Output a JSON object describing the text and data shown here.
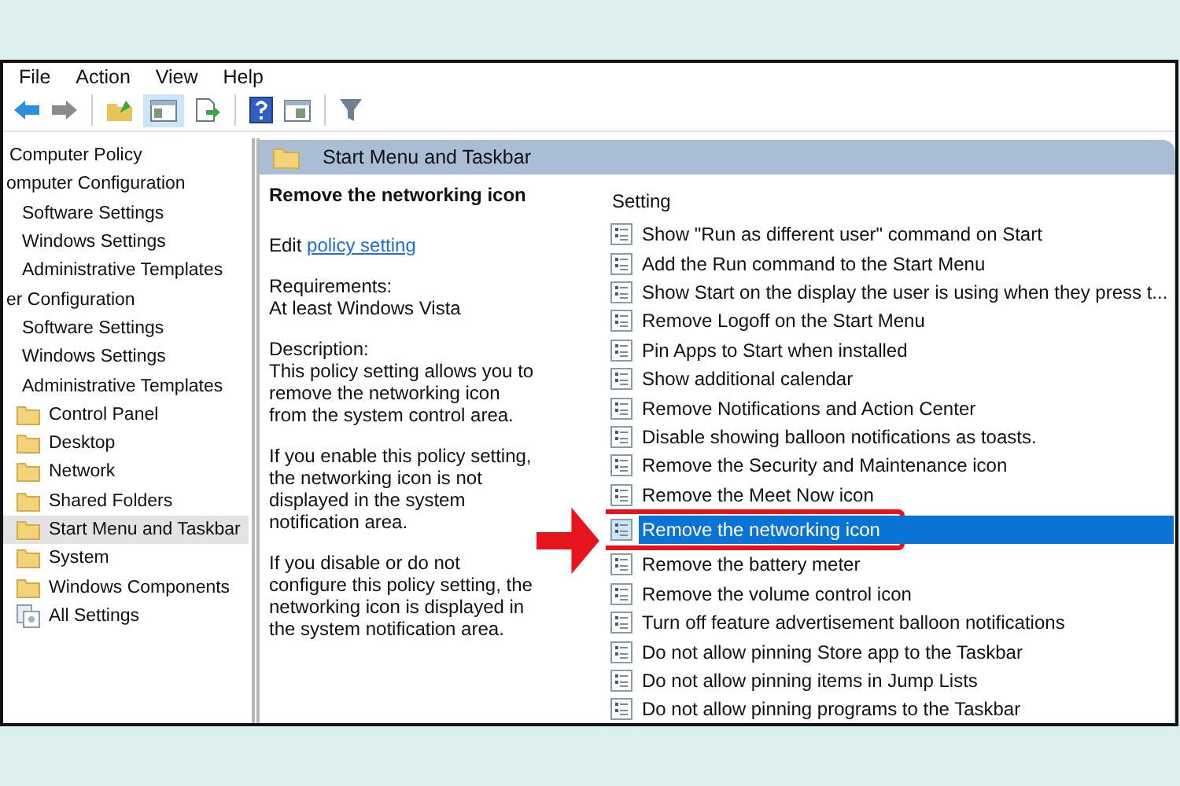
{
  "menu": [
    "File",
    "Action",
    "View",
    "Help"
  ],
  "toolbar": {
    "tree_toggle_on": true
  },
  "tree": [
    {
      "label": "Computer Policy",
      "selected": false,
      "children": [
        {
          "label": "omputer Configuration",
          "selected": false,
          "children": [
            {
              "label": "Software Settings",
              "selected": false
            },
            {
              "label": "Windows Settings",
              "selected": false
            },
            {
              "label": "Administrative Templates",
              "selected": false
            }
          ]
        },
        {
          "label": "er Configuration",
          "selected": false,
          "children": [
            {
              "label": "Software Settings",
              "selected": false
            },
            {
              "label": "Windows Settings",
              "selected": false
            },
            {
              "label": "Administrative Templates",
              "selected": false,
              "children": [
                {
                  "label": "Control Panel",
                  "selected": false,
                  "kind": "folder"
                },
                {
                  "label": "Desktop",
                  "selected": false,
                  "kind": "folder"
                },
                {
                  "label": "Network",
                  "selected": false,
                  "kind": "folder"
                },
                {
                  "label": "Shared Folders",
                  "selected": false,
                  "kind": "folder"
                },
                {
                  "label": "Start Menu and Taskbar",
                  "selected": true,
                  "kind": "folder"
                },
                {
                  "label": "System",
                  "selected": false,
                  "kind": "folder"
                },
                {
                  "label": "Windows Components",
                  "selected": false,
                  "kind": "folder"
                },
                {
                  "label": "All Settings",
                  "selected": false,
                  "kind": "settings"
                }
              ]
            }
          ]
        }
      ]
    }
  ],
  "header": {
    "title": "Start Menu and Taskbar"
  },
  "details": {
    "title": "Remove the networking icon",
    "edit_prefix": "Edit",
    "edit_link": "policy setting",
    "requirements_label": "Requirements:",
    "requirements": "At least Windows Vista",
    "description_label": "Description:",
    "paragraphs": [
      "This policy setting allows you to remove the networking icon from the system control area.",
      "If you enable this policy setting, the networking icon is not displayed in the system notification area.",
      "If you disable or do not configure this policy setting, the networking icon is displayed in the system notification area."
    ]
  },
  "settings": {
    "column": "Setting",
    "rows": [
      {
        "label": "Show \"Run as different user\" command on Start",
        "selected": false
      },
      {
        "label": "Add the Run command to the Start Menu",
        "selected": false
      },
      {
        "label": "Show Start on the display the user is using when they press t...",
        "selected": false
      },
      {
        "label": "Remove Logoff on the Start Menu",
        "selected": false
      },
      {
        "label": "Pin Apps to Start when installed",
        "selected": false
      },
      {
        "label": "Show additional calendar",
        "selected": false
      },
      {
        "label": "Remove Notifications and Action Center",
        "selected": false
      },
      {
        "label": "Disable showing balloon notifications as toasts.",
        "selected": false
      },
      {
        "label": "Remove the Security and Maintenance icon",
        "selected": false
      },
      {
        "label": "Remove the Meet Now icon",
        "selected": false
      },
      {
        "label": "Remove the networking icon",
        "selected": true,
        "highlighted": true
      },
      {
        "label": "Remove the battery meter",
        "selected": false
      },
      {
        "label": "Remove the volume control icon",
        "selected": false
      },
      {
        "label": "Turn off feature advertisement balloon notifications",
        "selected": false
      },
      {
        "label": "Do not allow pinning Store app to the Taskbar",
        "selected": false
      },
      {
        "label": "Do not allow pinning items in Jump Lists",
        "selected": false
      },
      {
        "label": "Do not allow pinning programs to the Taskbar",
        "selected": false
      }
    ]
  },
  "overlay": {
    "arrow": true
  }
}
